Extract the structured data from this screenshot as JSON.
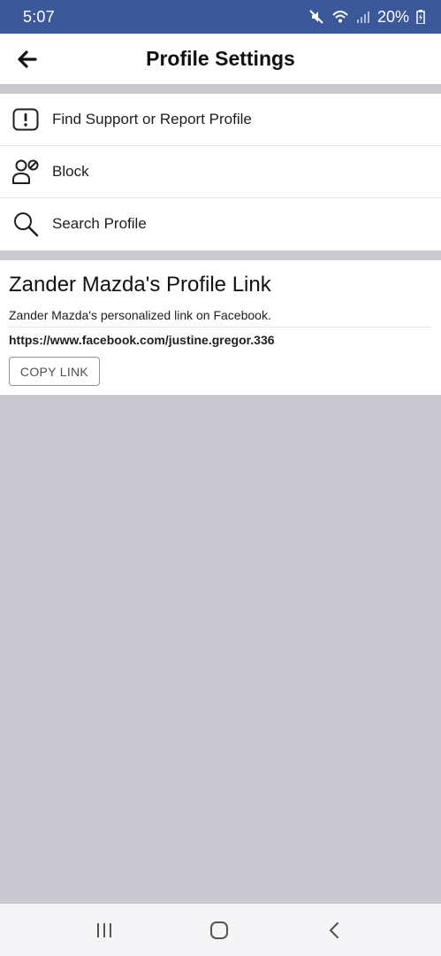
{
  "status_bar": {
    "time": "5:07",
    "battery": "20%",
    "icons": [
      "mute-icon",
      "wifi-icon",
      "signal-icon",
      "battery-charging-icon"
    ],
    "background": "#3b5998"
  },
  "header": {
    "title": "Profile Settings",
    "back_icon": "arrow-left-icon"
  },
  "options": [
    {
      "label": "Find Support or Report Profile",
      "icon": "report-icon"
    },
    {
      "label": "Block",
      "icon": "block-user-icon"
    },
    {
      "label": "Search Profile",
      "icon": "search-icon"
    }
  ],
  "profile_link": {
    "title": "Zander Mazda's Profile Link",
    "description": "Zander Mazda's personalized link on Facebook.",
    "url": "https://www.facebook.com/justine.gregor.336",
    "copy_label": "COPY LINK"
  },
  "nav_bar": {
    "buttons": [
      "recent-apps-icon",
      "home-icon",
      "back-icon"
    ]
  }
}
